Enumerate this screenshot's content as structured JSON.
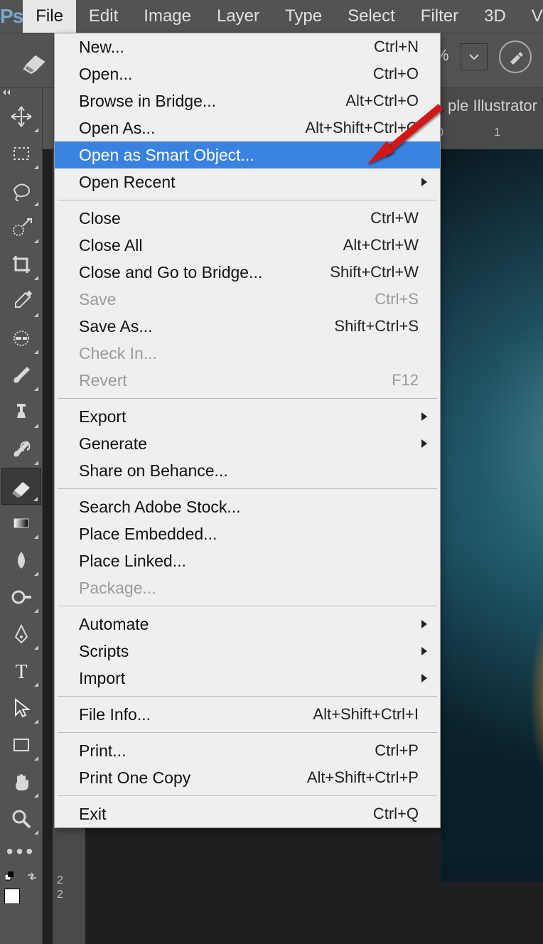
{
  "app": {
    "logo": "Ps"
  },
  "menubar": [
    "File",
    "Edit",
    "Image",
    "Layer",
    "Type",
    "Select",
    "Filter",
    "3D",
    "View"
  ],
  "menubar_active_index": 0,
  "optbar": {
    "percent_suffix": "%",
    "doc_tab": "ple Illustrator"
  },
  "ruler": {
    "h": [
      "0",
      "1"
    ],
    "v": [
      "2",
      "2"
    ]
  },
  "toolbar": {
    "tools": [
      {
        "name": "move-tool"
      },
      {
        "name": "marquee-tool"
      },
      {
        "name": "lasso-tool"
      },
      {
        "name": "quick-select-tool"
      },
      {
        "name": "crop-tool"
      },
      {
        "name": "eyedropper-tool"
      },
      {
        "name": "healing-brush-tool"
      },
      {
        "name": "brush-tool"
      },
      {
        "name": "clone-stamp-tool"
      },
      {
        "name": "history-brush-tool"
      },
      {
        "name": "eraser-tool",
        "selected": true
      },
      {
        "name": "gradient-tool"
      },
      {
        "name": "blur-tool"
      },
      {
        "name": "dodge-tool"
      },
      {
        "name": "pen-tool"
      },
      {
        "name": "type-tool"
      },
      {
        "name": "path-select-tool"
      },
      {
        "name": "rectangle-shape-tool"
      },
      {
        "name": "hand-tool"
      },
      {
        "name": "zoom-tool"
      }
    ]
  },
  "file_menu": [
    {
      "type": "item",
      "label": "New...",
      "shortcut": "Ctrl+N"
    },
    {
      "type": "item",
      "label": "Open...",
      "shortcut": "Ctrl+O"
    },
    {
      "type": "item",
      "label": "Browse in Bridge...",
      "shortcut": "Alt+Ctrl+O"
    },
    {
      "type": "item",
      "label": "Open As...",
      "shortcut": "Alt+Shift+Ctrl+O"
    },
    {
      "type": "item",
      "label": "Open as Smart Object...",
      "highlight": true
    },
    {
      "type": "item",
      "label": "Open Recent",
      "submenu": true
    },
    {
      "type": "sep"
    },
    {
      "type": "item",
      "label": "Close",
      "shortcut": "Ctrl+W"
    },
    {
      "type": "item",
      "label": "Close All",
      "shortcut": "Alt+Ctrl+W"
    },
    {
      "type": "item",
      "label": "Close and Go to Bridge...",
      "shortcut": "Shift+Ctrl+W"
    },
    {
      "type": "item",
      "label": "Save",
      "shortcut": "Ctrl+S",
      "disabled": true
    },
    {
      "type": "item",
      "label": "Save As...",
      "shortcut": "Shift+Ctrl+S"
    },
    {
      "type": "item",
      "label": "Check In...",
      "disabled": true
    },
    {
      "type": "item",
      "label": "Revert",
      "shortcut": "F12",
      "disabled": true
    },
    {
      "type": "sep"
    },
    {
      "type": "item",
      "label": "Export",
      "submenu": true
    },
    {
      "type": "item",
      "label": "Generate",
      "submenu": true
    },
    {
      "type": "item",
      "label": "Share on Behance..."
    },
    {
      "type": "sep"
    },
    {
      "type": "item",
      "label": "Search Adobe Stock..."
    },
    {
      "type": "item",
      "label": "Place Embedded..."
    },
    {
      "type": "item",
      "label": "Place Linked..."
    },
    {
      "type": "item",
      "label": "Package...",
      "disabled": true
    },
    {
      "type": "sep"
    },
    {
      "type": "item",
      "label": "Automate",
      "submenu": true
    },
    {
      "type": "item",
      "label": "Scripts",
      "submenu": true
    },
    {
      "type": "item",
      "label": "Import",
      "submenu": true
    },
    {
      "type": "sep"
    },
    {
      "type": "item",
      "label": "File Info...",
      "shortcut": "Alt+Shift+Ctrl+I"
    },
    {
      "type": "sep"
    },
    {
      "type": "item",
      "label": "Print...",
      "shortcut": "Ctrl+P"
    },
    {
      "type": "item",
      "label": "Print One Copy",
      "shortcut": "Alt+Shift+Ctrl+P"
    },
    {
      "type": "sep"
    },
    {
      "type": "item",
      "label": "Exit",
      "shortcut": "Ctrl+Q"
    }
  ],
  "colors": {
    "menu_highlight": "#3a82e0",
    "ui_bg": "#535353"
  }
}
